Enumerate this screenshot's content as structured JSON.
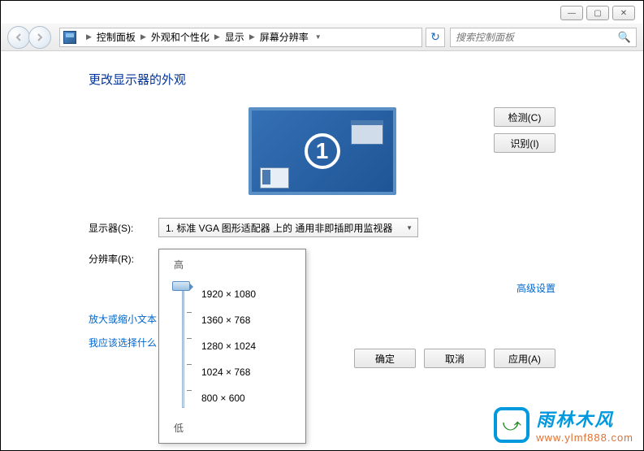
{
  "window_controls": {
    "min": "—",
    "max": "▢",
    "close": "✕"
  },
  "breadcrumb": {
    "items": [
      "控制面板",
      "外观和个性化",
      "显示",
      "屏幕分辨率"
    ]
  },
  "search": {
    "placeholder": "搜索控制面板"
  },
  "page_title": "更改显示器的外观",
  "monitor_number": "1",
  "buttons": {
    "detect": "检测(C)",
    "identify": "识别(I)",
    "ok": "确定",
    "cancel": "取消",
    "apply": "应用(A)"
  },
  "labels": {
    "display": "显示器(S):",
    "resolution": "分辨率(R):",
    "high": "高",
    "low": "低"
  },
  "selects": {
    "display_value": "1. 标准 VGA 图形适配器 上的 通用非即插即用监视器",
    "resolution_value": "1920 × 1080"
  },
  "links": {
    "advanced": "高级设置",
    "text_size": "放大或缩小文本",
    "which_setting": "我应该选择什么"
  },
  "resolution_options": [
    "1920 × 1080",
    "1360 × 768",
    "1280 × 1024",
    "1024 × 768",
    "800 × 600"
  ],
  "watermark": {
    "title": "雨林木风",
    "url": "www.ylmf888.com"
  }
}
